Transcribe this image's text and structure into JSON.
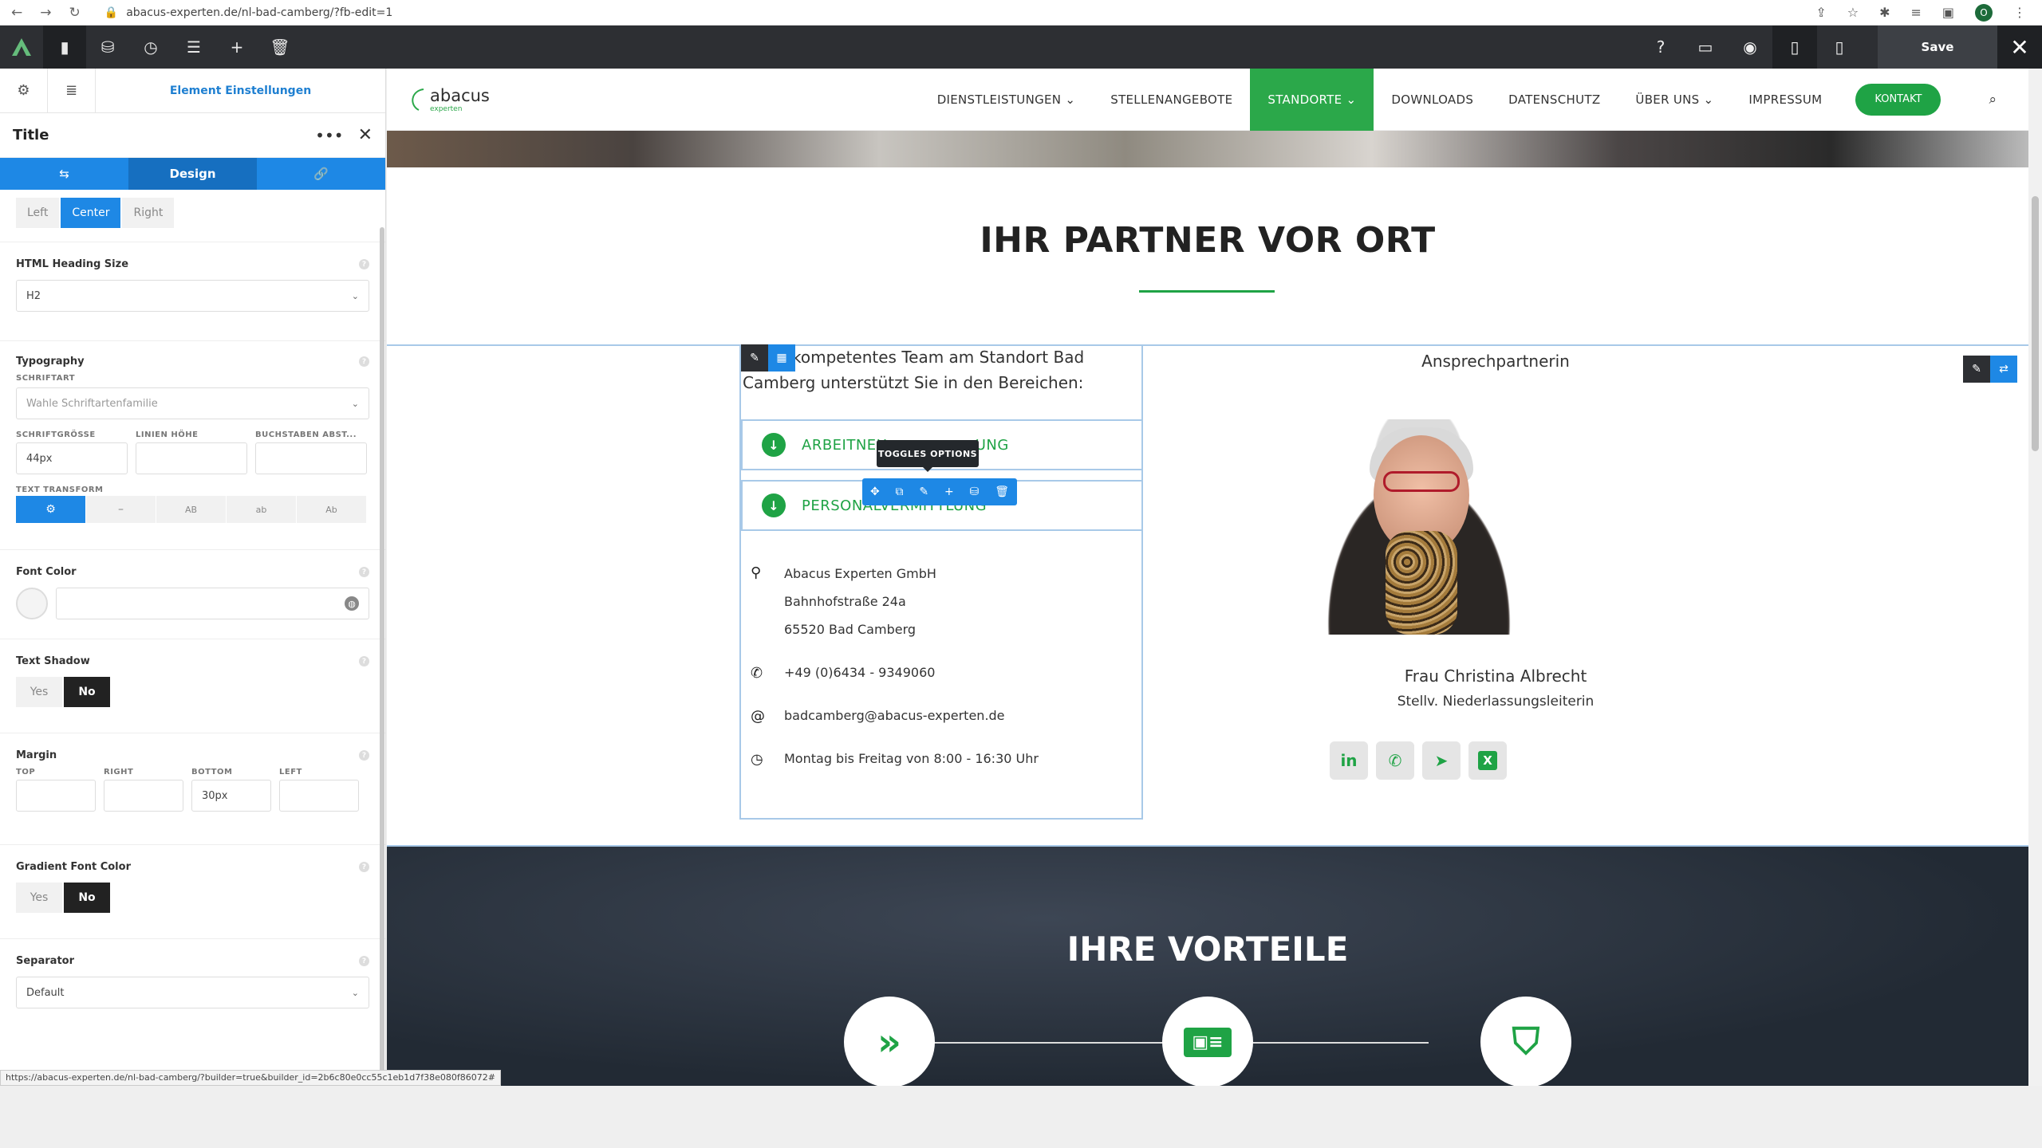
{
  "browser": {
    "url": "abacus-experten.de/nl-bad-camberg/?fb-edit=1",
    "profile": "O"
  },
  "fusion": {
    "save": "Save"
  },
  "sidebar": {
    "header_title": "Element Einstellungen",
    "element_title": "Title",
    "tabs": [
      "",
      "Design",
      ""
    ],
    "alignment": [
      "Left",
      "Center",
      "Right"
    ],
    "heading_size": {
      "label": "HTML Heading Size",
      "value": "H2"
    },
    "typography": {
      "label": "Typography",
      "font_label": "SCHRIFTART",
      "font_placeholder": "Wahle Schriftartenfamilie",
      "size_label": "SCHRIFTGRÖSSE",
      "size_value": "44px",
      "lh_label": "LINIEN HÖHE",
      "ls_label": "BUCHSTABEN ABST...",
      "tt_label": "TEXT TRANSFORM",
      "tt_options": [
        "⚙",
        "–",
        "AB",
        "ab",
        "Ab"
      ]
    },
    "font_color": {
      "label": "Font Color"
    },
    "text_shadow": {
      "label": "Text Shadow",
      "yes": "Yes",
      "no": "No"
    },
    "margin": {
      "label": "Margin",
      "top": "TOP",
      "right": "RIGHT",
      "bottom": "BOTTOM",
      "left": "LEFT",
      "bottom_value": "30px"
    },
    "gradient": {
      "label": "Gradient Font Color",
      "yes": "Yes",
      "no": "No"
    },
    "separator": {
      "label": "Separator",
      "value": "Default"
    }
  },
  "status_url": "https://abacus-experten.de/nl-bad-camberg/?builder=true&builder_id=2b6c80e0cc55c1eb1d7f38e080f86072#",
  "site": {
    "logo": "abacus",
    "logo_sub": "experten",
    "menu": [
      "DIENSTLEISTUNGEN ⌄",
      "STELLENANGEBOTE",
      "STANDORTE ⌄",
      "DOWNLOADS",
      "DATENSCHUTZ",
      "ÜBER UNS ⌄",
      "IMPRESSUM"
    ],
    "kontakt": "KONTAKT",
    "heading1": "IHR PARTNER VOR ORT",
    "intro": "kompetentes Team am Standort Bad Camberg unterstützt Sie in den Bereichen:",
    "toggles": [
      "ARBEITNEH",
      "UNG",
      "PERSONALVERMITTLUNG"
    ],
    "tooltip": "TOGGLES OPTIONS",
    "address": [
      "Abacus Experten GmbH",
      "Bahnhofstraße 24a",
      "65520 Bad Camberg"
    ],
    "phone": "+49 (0)6434 - 9349060",
    "email": "badcamberg@abacus-experten.de",
    "hours": "Montag bis Freitag von 8:00 - 16:30 Uhr",
    "contact_heading": "Ansprechpartnerin",
    "contact_name": "Frau Christina Albrecht",
    "contact_role": "Stellv. Niederlassungsleiterin",
    "heading2": "IHRE VORTEILE"
  }
}
